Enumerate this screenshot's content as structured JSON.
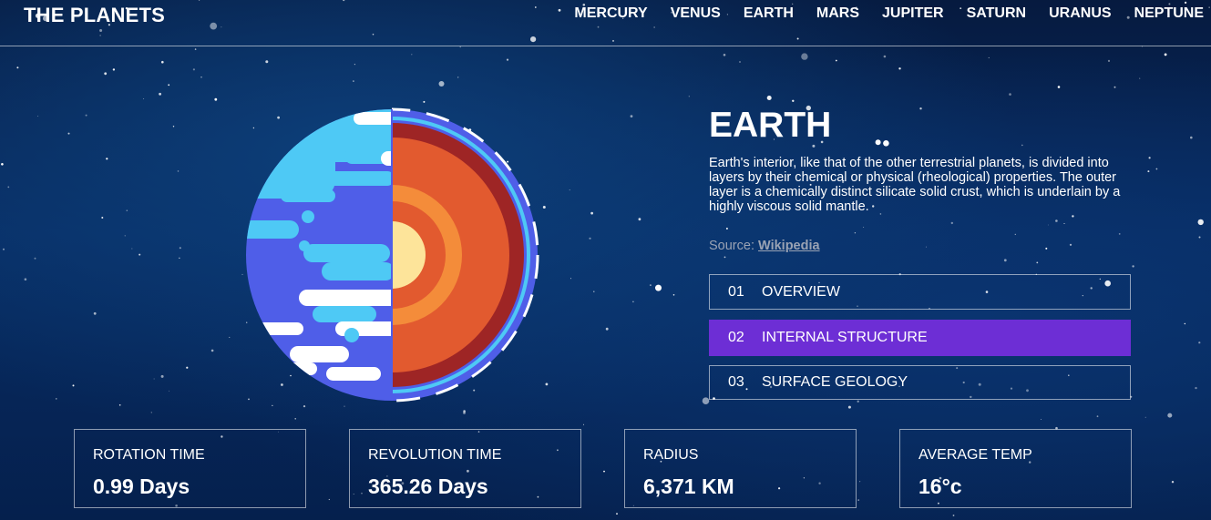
{
  "header": {
    "logo": "THE PLANETS",
    "nav": [
      "MERCURY",
      "VENUS",
      "EARTH",
      "MARS",
      "JUPITER",
      "SATURN",
      "URANUS",
      "NEPTUNE"
    ]
  },
  "planet": {
    "name": "EARTH",
    "description": "Earth's interior, like that of the other terrestrial planets, is divided into layers by their chemical or physical (rheological) properties. The outer layer is a chemically distinct silicate solid crust, which is underlain by a highly viscous solid mantle.",
    "source_label": "Source:",
    "source_link": "Wikipedia",
    "icon": "earth-internal-structure-illustration"
  },
  "tabs": [
    {
      "num": "01",
      "label": "OVERVIEW"
    },
    {
      "num": "02",
      "label": "INTERNAL STRUCTURE"
    },
    {
      "num": "03",
      "label": "SURFACE GEOLOGY"
    }
  ],
  "stats": [
    {
      "label": "ROTATION TIME",
      "value": "0.99 Days"
    },
    {
      "label": "REVOLUTION TIME",
      "value": "365.26 Days"
    },
    {
      "label": "RADIUS",
      "value": "6,371 KM"
    },
    {
      "label": "AVERAGE TEMP",
      "value": "16°c"
    }
  ],
  "colors": {
    "accent": "#6d2ed5",
    "ocean": "#4f5ee8",
    "land": "#4ec9f5",
    "crust": "#9e2525",
    "mantle": "#e25a2f",
    "outer_core": "#f48c3a",
    "inner_core": "#fde49a"
  }
}
